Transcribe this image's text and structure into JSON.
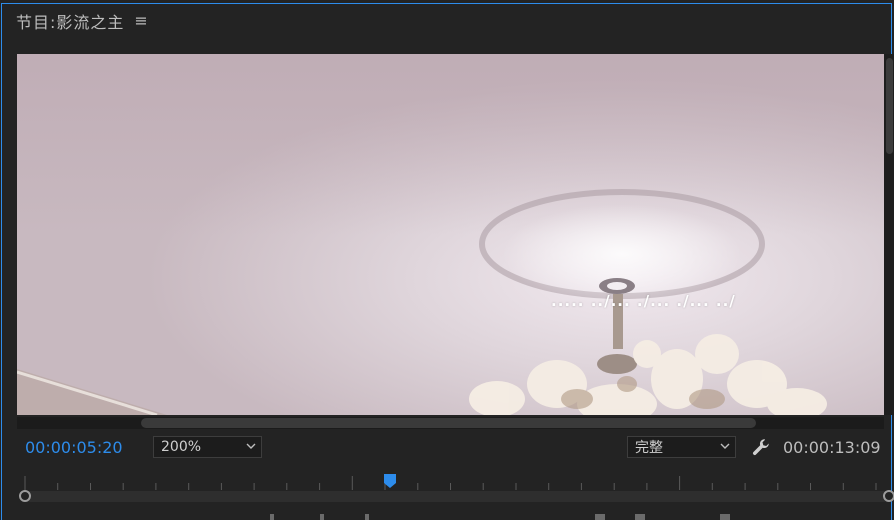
{
  "panel": {
    "title": "节目:影流之主",
    "menu_icon": "hamburger-menu-icon",
    "accent_color": "#2d8ceb"
  },
  "viewer": {
    "caption": "..... ../... ./... ./... ../"
  },
  "playback": {
    "current_timecode": "00:00:05:20",
    "duration_timecode": "00:00:13:09",
    "zoom_level": "200%",
    "quality": "完整",
    "settings_icon": "wrench-icon",
    "playhead_position_fraction": 0.43
  }
}
